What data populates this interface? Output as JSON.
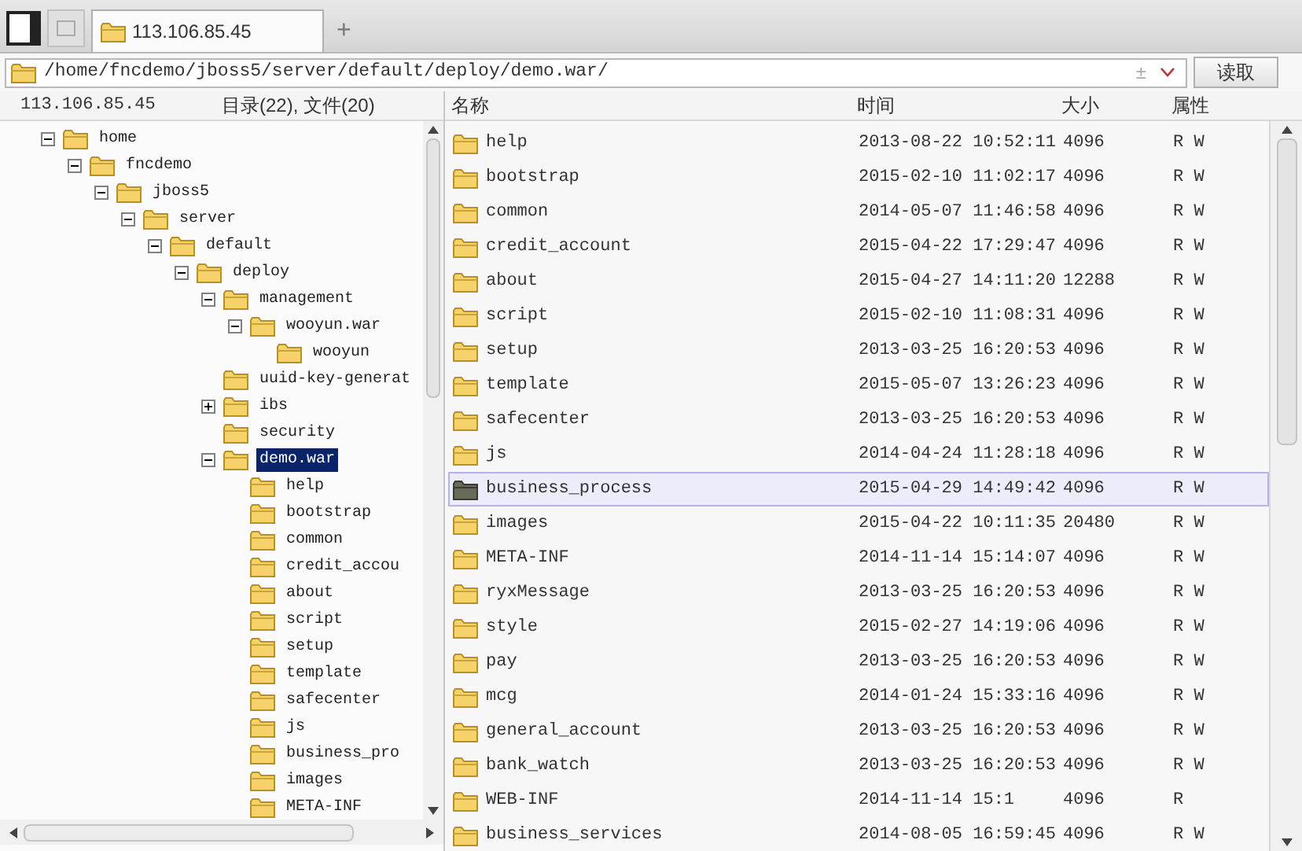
{
  "tab": {
    "label": "113.106.85.45",
    "selected": true
  },
  "new_tab": "+",
  "address": {
    "path": "/home/fncdemo/jboss5/server/default/deploy/demo.war/",
    "toggle": "±",
    "button": "读取"
  },
  "tree_header": {
    "host": "113.106.85.45",
    "summary": "目录(22), 文件(20)"
  },
  "tree": [
    {
      "name": "home",
      "expanded": true,
      "selected": false,
      "children": [
        {
          "name": "fncdemo",
          "expanded": true,
          "selected": false,
          "children": [
            {
              "name": "jboss5",
              "expanded": true,
              "selected": false,
              "children": [
                {
                  "name": "server",
                  "expanded": true,
                  "selected": false,
                  "children": [
                    {
                      "name": "default",
                      "expanded": true,
                      "selected": false,
                      "children": [
                        {
                          "name": "deploy",
                          "expanded": true,
                          "selected": false,
                          "children": [
                            {
                              "name": "management",
                              "expanded": true,
                              "selected": false,
                              "children": [
                                {
                                  "name": "wooyun.war",
                                  "expanded": true,
                                  "selected": false,
                                  "children": [
                                    {
                                      "name": "wooyun",
                                      "selected": false
                                    }
                                  ]
                                }
                              ]
                            },
                            {
                              "name": "uuid-key-generat",
                              "selected": false
                            },
                            {
                              "name": "ibs",
                              "expanded": false,
                              "selected": false
                            },
                            {
                              "name": "security",
                              "selected": false
                            },
                            {
                              "name": "demo.war",
                              "expanded": true,
                              "selected": true,
                              "children": [
                                {
                                  "name": "help",
                                  "selected": false
                                },
                                {
                                  "name": "bootstrap",
                                  "selected": false
                                },
                                {
                                  "name": "common",
                                  "selected": false
                                },
                                {
                                  "name": "credit_accou",
                                  "selected": false
                                },
                                {
                                  "name": "about",
                                  "selected": false
                                },
                                {
                                  "name": "script",
                                  "selected": false
                                },
                                {
                                  "name": "setup",
                                  "selected": false
                                },
                                {
                                  "name": "template",
                                  "selected": false
                                },
                                {
                                  "name": "safecenter",
                                  "selected": false
                                },
                                {
                                  "name": "js",
                                  "selected": false
                                },
                                {
                                  "name": "business_pro",
                                  "selected": false
                                },
                                {
                                  "name": "images",
                                  "selected": false
                                },
                                {
                                  "name": "META-INF",
                                  "selected": false
                                }
                              ]
                            }
                          ]
                        }
                      ]
                    }
                  ]
                }
              ]
            }
          ]
        }
      ]
    }
  ],
  "columns": [
    "名称",
    "时间",
    "大小",
    "属性"
  ],
  "rows": [
    {
      "name": "help",
      "time": "2013-08-22 10:52:11",
      "size": "4096",
      "attr": "R W",
      "selected": false
    },
    {
      "name": "bootstrap",
      "time": "2015-02-10 11:02:17",
      "size": "4096",
      "attr": "R W",
      "selected": false
    },
    {
      "name": "common",
      "time": "2014-05-07 11:46:58",
      "size": "4096",
      "attr": "R W",
      "selected": false
    },
    {
      "name": "credit_account",
      "time": "2015-04-22 17:29:47",
      "size": "4096",
      "attr": "R W",
      "selected": false
    },
    {
      "name": "about",
      "time": "2015-04-27 14:11:20",
      "size": "12288",
      "attr": "R W",
      "selected": false
    },
    {
      "name": "script",
      "time": "2015-02-10 11:08:31",
      "size": "4096",
      "attr": "R W",
      "selected": false
    },
    {
      "name": "setup",
      "time": "2013-03-25 16:20:53",
      "size": "4096",
      "attr": "R W",
      "selected": false
    },
    {
      "name": "template",
      "time": "2015-05-07 13:26:23",
      "size": "4096",
      "attr": "R W",
      "selected": false
    },
    {
      "name": "safecenter",
      "time": "2013-03-25 16:20:53",
      "size": "4096",
      "attr": "R W",
      "selected": false
    },
    {
      "name": "js",
      "time": "2014-04-24 11:28:18",
      "size": "4096",
      "attr": "R W",
      "selected": false
    },
    {
      "name": "business_process",
      "time": "2015-04-29 14:49:42",
      "size": "4096",
      "attr": "R W",
      "selected": true
    },
    {
      "name": "images",
      "time": "2015-04-22 10:11:35",
      "size": "20480",
      "attr": "R W",
      "selected": false
    },
    {
      "name": "META-INF",
      "time": "2014-11-14 15:14:07",
      "size": "4096",
      "attr": "R W",
      "selected": false
    },
    {
      "name": "ryxMessage",
      "time": "2013-03-25 16:20:53",
      "size": "4096",
      "attr": "R W",
      "selected": false
    },
    {
      "name": "style",
      "time": "2015-02-27 14:19:06",
      "size": "4096",
      "attr": "R W",
      "selected": false
    },
    {
      "name": "pay",
      "time": "2013-03-25 16:20:53",
      "size": "4096",
      "attr": "R W",
      "selected": false
    },
    {
      "name": "mcg",
      "time": "2014-01-24 15:33:16",
      "size": "4096",
      "attr": "R W",
      "selected": false
    },
    {
      "name": "general_account",
      "time": "2013-03-25 16:20:53",
      "size": "4096",
      "attr": "R W",
      "selected": false
    },
    {
      "name": "bank_watch",
      "time": "2013-03-25 16:20:53",
      "size": "4096",
      "attr": "R W",
      "selected": false
    },
    {
      "name": "WEB-INF",
      "time": "2014-11-14 15:1",
      "size": "4096",
      "attr": "R",
      "selected": false
    },
    {
      "name": "business_services",
      "time": "2014-08-05 16:59:45",
      "size": "4096",
      "attr": "R W",
      "selected": false
    }
  ]
}
